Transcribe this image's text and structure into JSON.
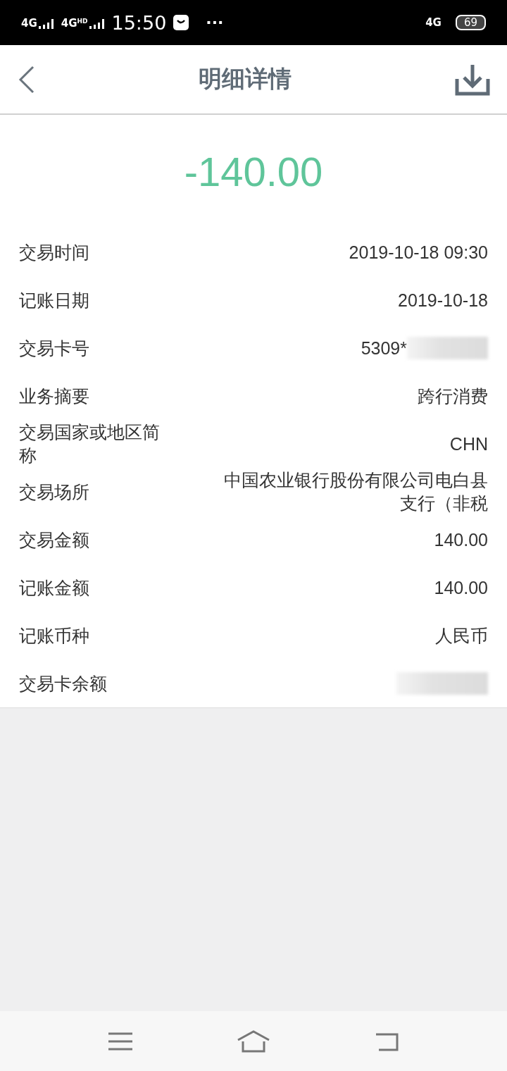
{
  "status_bar": {
    "signals": [
      "4G",
      "4G"
    ],
    "signal_badge": "HD",
    "time": "15:50",
    "more": "···",
    "network": "4G",
    "battery": "69"
  },
  "header": {
    "title": "明细详情"
  },
  "amount": "-140.00",
  "rows": [
    {
      "label": "交易时间",
      "value": "2019-10-18 09:30"
    },
    {
      "label": "记账日期",
      "value": "2019-10-18"
    },
    {
      "label": "交易卡号",
      "value": "5309*",
      "masked": true
    },
    {
      "label": "业务摘要",
      "value": "跨行消费"
    },
    {
      "label": "交易国家或地区简称",
      "value": "CHN"
    },
    {
      "label": "交易场所",
      "value": "中国农业银行股份有限公司电白县支行（非税"
    },
    {
      "label": "交易金额",
      "value": "140.00"
    },
    {
      "label": "记账金额",
      "value": "140.00"
    },
    {
      "label": "记账币种",
      "value": "人民币"
    },
    {
      "label": "交易卡余额",
      "masked": true
    }
  ]
}
